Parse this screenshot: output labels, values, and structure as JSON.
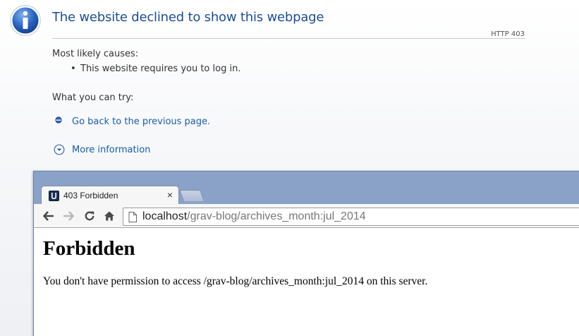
{
  "error_page": {
    "title": "The website declined to show this webpage",
    "http_code": "HTTP 403",
    "causes_heading": "Most likely causes:",
    "causes": [
      "This website requires you to log in."
    ],
    "try_heading": "What you can try:",
    "go_back_link": "Go back to the previous page.",
    "more_info_link": "More information"
  },
  "browser": {
    "tab_title": "403 Forbidden",
    "tab_close": "×",
    "url_host": "localhost",
    "url_path": "/grav-blog/archives_month:jul_2014"
  },
  "page": {
    "heading": "Forbidden",
    "message": "You don't have permission to access /grav-blog/archives_month:jul_2014 on this server."
  },
  "colors": {
    "title_blue": "#1f4e8c",
    "link_blue": "#1a5ea0",
    "chrome_frame": "#8aa2c8"
  }
}
